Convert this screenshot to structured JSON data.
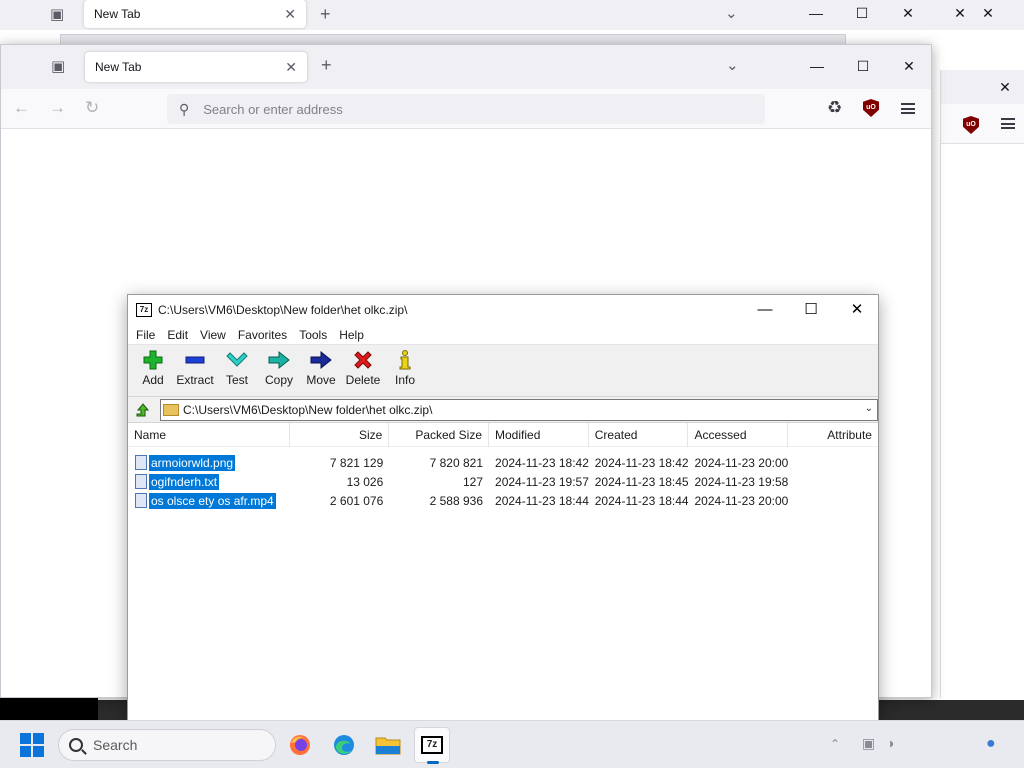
{
  "firefox": {
    "tab_title": "New Tab",
    "address_placeholder": "Search or enter address"
  },
  "zip": {
    "title": "C:\\Users\\VM6\\Desktop\\New folder\\het olkc.zip\\",
    "menu": [
      "File",
      "Edit",
      "View",
      "Favorites",
      "Tools",
      "Help"
    ],
    "toolbar": [
      "Add",
      "Extract",
      "Test",
      "Copy",
      "Move",
      "Delete",
      "Info"
    ],
    "address": "C:\\Users\\VM6\\Desktop\\New folder\\het olkc.zip\\",
    "columns": [
      "Name",
      "Size",
      "Packed Size",
      "Modified",
      "Created",
      "Accessed",
      "Attribute"
    ],
    "files": [
      {
        "name": "armoiorwld.png",
        "size": "7 821 129",
        "packed": "7 820 821",
        "modified": "2024-11-23 18:42",
        "created": "2024-11-23 18:42",
        "accessed": "2024-11-23 20:00"
      },
      {
        "name": "ogifnderh.txt",
        "size": "13 026",
        "packed": "127",
        "modified": "2024-11-23 19:57",
        "created": "2024-11-23 18:45",
        "accessed": "2024-11-23 19:58"
      },
      {
        "name": "os olsce ety os afr.mp4",
        "size": "2 601 076",
        "packed": "2 588 936",
        "modified": "2024-11-23 18:44",
        "created": "2024-11-23 18:44",
        "accessed": "2024-11-23 20:00"
      }
    ],
    "colors": {
      "selection": "#0078d7"
    }
  },
  "taskbar": {
    "search_placeholder": "Search"
  }
}
